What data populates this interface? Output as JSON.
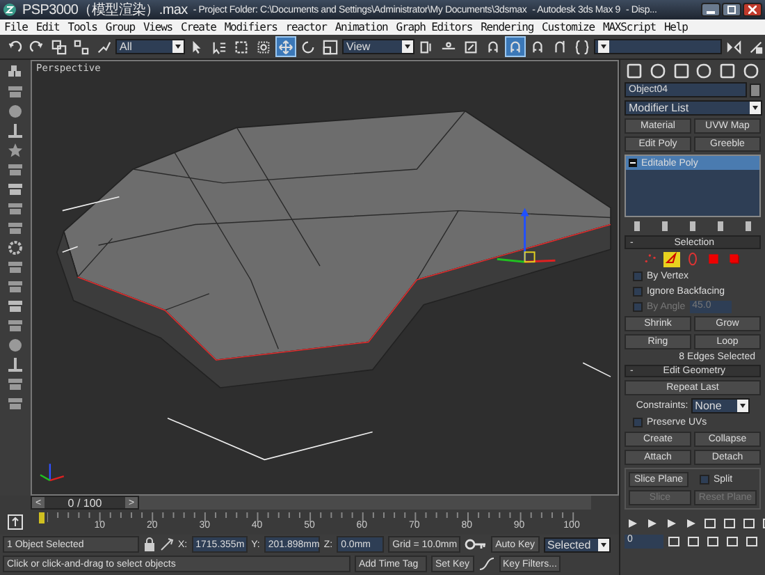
{
  "window": {
    "title_parts": [
      "PSP3000（模型渲染）.max",
      "- Project Folder: C:\\Documents and Settings\\Administrator\\My Documents\\3dsmax",
      "- Autodesk 3ds Max 9",
      "- Disp..."
    ]
  },
  "menu": [
    "File",
    "Edit",
    "Tools",
    "Group",
    "Views",
    "Create",
    "Modifiers",
    "reactor",
    "Animation",
    "Graph Editors",
    "Rendering",
    "Customize",
    "MAXScript",
    "Help"
  ],
  "toolbar": {
    "selection_filter": "All",
    "reference_coord": "View",
    "tools": [
      {
        "kind": "undo",
        "selected": false
      },
      {
        "kind": "redo",
        "selected": false
      },
      {
        "kind": "link",
        "selected": false
      },
      {
        "kind": "unlink",
        "selected": false
      },
      {
        "kind": "bind",
        "selected": false
      },
      {
        "kind": "filter"
      },
      {
        "kind": "select",
        "selected": false
      },
      {
        "kind": "select-by-name",
        "selected": false
      },
      {
        "kind": "region",
        "selected": false
      },
      {
        "kind": "crossing",
        "selected": false
      },
      {
        "kind": "move",
        "selected": true
      },
      {
        "kind": "rotate",
        "selected": false
      },
      {
        "kind": "scale",
        "selected": false
      },
      {
        "kind": "coord"
      },
      {
        "kind": "pivot",
        "selected": false
      },
      {
        "kind": "manipulate",
        "selected": false
      },
      {
        "kind": "keyboard",
        "selected": false
      },
      {
        "kind": "snap",
        "selected": false
      },
      {
        "kind": "angle-snap",
        "selected": true
      },
      {
        "kind": "percent-snap",
        "selected": false
      },
      {
        "kind": "spinner-snap",
        "selected": false
      },
      {
        "kind": "named-selection",
        "selected": false
      },
      {
        "kind": "named"
      },
      {
        "kind": "mirror",
        "selected": false
      },
      {
        "kind": "align",
        "selected": false
      }
    ]
  },
  "viewport": {
    "label": "Perspective"
  },
  "command_panel": {
    "object_name": "Object04",
    "modifier_list": "Modifier List",
    "modifier_buttons": [
      "Material",
      "UVW Map",
      "Edit Poly",
      "Greeble"
    ],
    "stack": [
      {
        "label": "Editable Poly",
        "selected": true
      }
    ],
    "selection": {
      "title": "Selection",
      "collapse": "-",
      "levels": [
        {
          "kind": "vertex",
          "selected": false
        },
        {
          "kind": "edge",
          "selected": true
        },
        {
          "kind": "border",
          "selected": false
        },
        {
          "kind": "polygon",
          "selected": false
        },
        {
          "kind": "element",
          "selected": false
        }
      ],
      "options": [
        {
          "label": "By Vertex",
          "checked": false,
          "disabled": false
        },
        {
          "label": "Ignore Backfacing",
          "checked": false,
          "disabled": false
        },
        {
          "label": "By Angle",
          "checked": false,
          "disabled": true,
          "value": "45.0"
        }
      ],
      "buttons": [
        "Shrink",
        "Grow",
        "Ring",
        "Loop"
      ],
      "status": "8 Edges Selected"
    },
    "edit_geometry": {
      "title": "Edit Geometry",
      "collapse": "-",
      "repeat": "Repeat Last",
      "constraints_label": "Constraints:",
      "constraints_value": "None",
      "preserve_uvs": {
        "label": "Preserve UVs",
        "checked": false
      },
      "buttons": [
        {
          "label": "Create",
          "disabled": false
        },
        {
          "label": "Collapse",
          "disabled": false
        },
        {
          "label": "Attach",
          "disabled": false
        },
        {
          "label": "Detach",
          "disabled": false
        }
      ],
      "slice_plane": "Slice Plane",
      "split": {
        "label": "Split",
        "checked": false
      },
      "slice_buttons": [
        {
          "label": "Slice",
          "disabled": true
        },
        {
          "label": "Reset Plane",
          "disabled": true
        }
      ]
    },
    "time_field": "0"
  },
  "timeline": {
    "slider": "0 / 100",
    "level": 0,
    "prev": "<",
    "next": ">",
    "ruler_labels": [
      "10",
      "20",
      "30",
      "40",
      "50",
      "60",
      "70",
      "80",
      "90",
      "100"
    ]
  },
  "status_bar": {
    "selection": "1 Object Selected",
    "x_label": "X:",
    "x": "1715.355m",
    "y_label": "Y:",
    "y": "201.898mm",
    "z_label": "Z:",
    "z": "0.0mm",
    "grid": "Grid = 10.0mm",
    "auto_key": "Auto Key",
    "key_mode": "Selected",
    "prompt": "Click or click-and-drag to select objects",
    "time_tag": "Add Time Tag",
    "set_key": "Set Key",
    "key_filters": "Key Filters..."
  }
}
